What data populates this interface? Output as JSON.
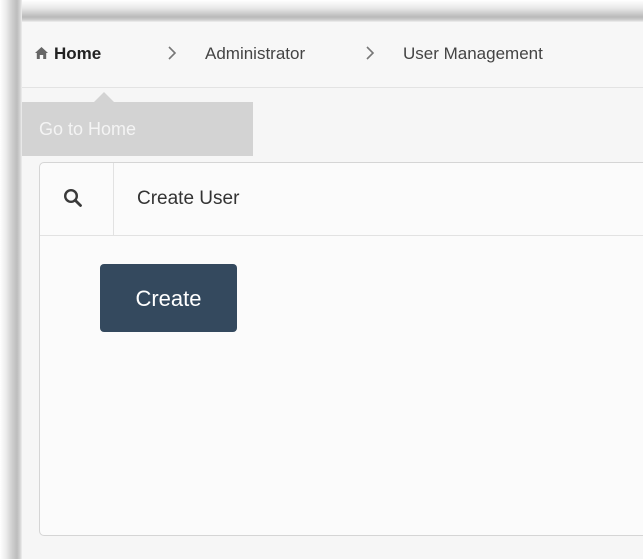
{
  "breadcrumb": {
    "items": [
      {
        "label": "Home",
        "icon": "home-icon"
      },
      {
        "label": "Administrator"
      },
      {
        "label": "User Management"
      }
    ],
    "separator_icon": "chevron-right-icon"
  },
  "tooltip": {
    "text": "Go to Home"
  },
  "panel": {
    "search_icon": "search-icon",
    "title": "Create User"
  },
  "actions": {
    "create_label": "Create"
  },
  "colors": {
    "button": "#34495e",
    "tooltip_bg": "#d3d3d3",
    "page_bg": "#f6f6f6"
  }
}
